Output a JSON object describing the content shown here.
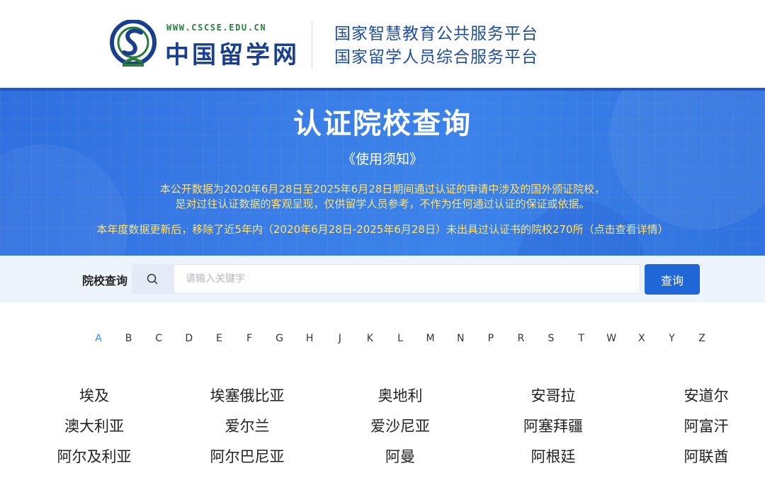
{
  "header": {
    "logo_url_text": "WWW.CSCSE.EDU.CN",
    "logo_name": "中国留学网",
    "platform_line_1": "国家智慧教育公共服务平台",
    "platform_line_2": "国家留学人员综合服务平台"
  },
  "banner": {
    "title": "认证院校查询",
    "notice_link": "《使用须知》",
    "text_line_1": "本公开数据为2020年6月28日至2025年6月28日期间通过认证的申请中涉及的国外颁证院校，",
    "text_line_2": "是对过往认证数据的客观呈现，仅供留学人员参考，不作为任何通过认证的保证或依据。",
    "text_line_3": "本年度数据更新后，移除了近5年内（2020年6月28日-2025年6月28日）未出具过认证书的院校270所（点击查看详情）"
  },
  "search": {
    "label": "院校查询",
    "placeholder": "请输入关键字",
    "value": "",
    "button_label": "查询"
  },
  "alphabet": {
    "letters": [
      "A",
      "B",
      "C",
      "D",
      "E",
      "F",
      "G",
      "H",
      "J",
      "K",
      "L",
      "M",
      "N",
      "P",
      "R",
      "S",
      "T",
      "W",
      "X",
      "Y",
      "Z"
    ],
    "active": "A"
  },
  "countries": [
    [
      "埃及",
      "埃塞俄比亚",
      "奥地利",
      "安哥拉",
      "安道尔"
    ],
    [
      "澳大利亚",
      "爱尔兰",
      "爱沙尼亚",
      "阿塞拜疆",
      "阿富汗"
    ],
    [
      "阿尔及利亚",
      "阿尔巴尼亚",
      "阿曼",
      "阿根廷",
      "阿联酋"
    ]
  ],
  "colors": {
    "brand_blue": "#1f66d6",
    "banner_blue": "#3a7ee8",
    "notice_yellow": "#ffe27a",
    "active_letter": "#3a8ee6"
  }
}
